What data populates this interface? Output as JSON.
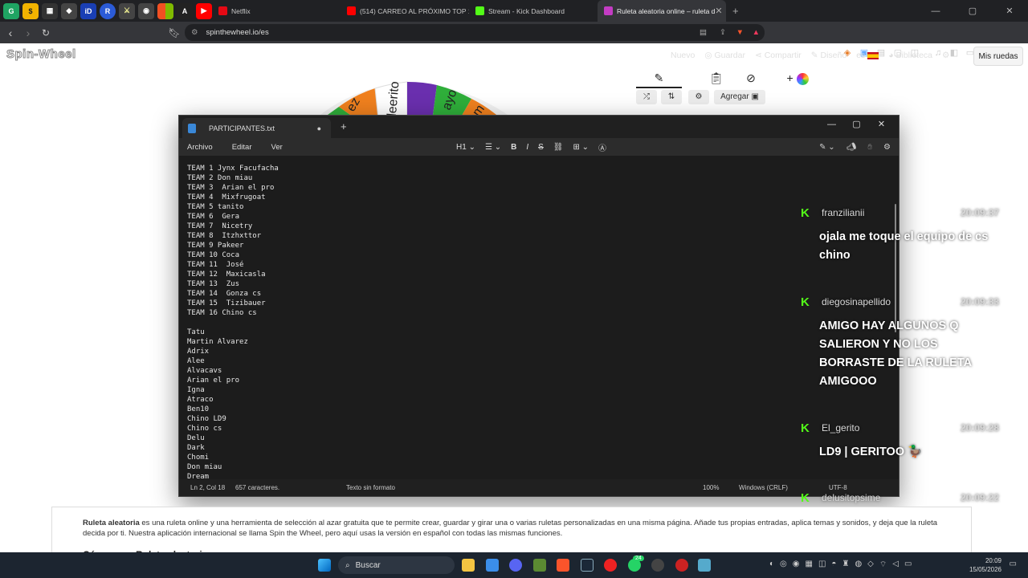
{
  "browser": {
    "tabs": [
      {
        "label": "Netflix",
        "color": "#e50914"
      },
      {
        "label": "(514) CARREO AL PRÓXIMO TOP 1 D",
        "color": "#ff0000"
      },
      {
        "label": "Stream - Kick Dashboard",
        "color": "#53fc18"
      },
      {
        "label": "Ruleta aleatoria online – ruleta d",
        "color": "#c43cc4",
        "active": true
      }
    ],
    "url": "spinthewheel.io/es"
  },
  "page": {
    "logo": "Spin-Wheel",
    "menu": [
      "Nuevo",
      "Guardar",
      "Compartir",
      "Diseño",
      "es",
      "Biblioteca"
    ],
    "mis_ruedas": "Mis ruedas",
    "agregar": "Agregar",
    "wheel_labels": [
      "ez",
      "aleerito",
      "ayo",
      "m"
    ],
    "description": "es una ruleta online y una herramienta de selección al azar gratuita que te permite crear, guardar y girar una o varias ruletas personalizadas en una misma página. Añade tus propias entradas, aplica temas y sonidos, y deja que la ruleta decida por ti. Nuestra aplicación internacional se llama Spin the Wheel, pero aquí usas la versión en español con todas las mismas funciones.",
    "description_strong": "Ruleta aleatoria",
    "howto_heading": "Cómo usar Ruleta aleatoria"
  },
  "notepad": {
    "tab_title": "PARTICIPANTES.txt",
    "menu": [
      "Archivo",
      "Editar",
      "Ver"
    ],
    "heading_select": "H1",
    "lines": [
      "TEAM 1 Jynx Facufacha",
      "TEAM 2 Don miau",
      "TEAM 3  Arian el pro",
      "TEAM 4  Mixfrugoat",
      "TEAM 5 tanito",
      "TEAM 6  Gera",
      "TEAM 7  Nicetry",
      "TEAM 8  Itzhxttor",
      "TEAM 9 Pakeer",
      "TEAM 10 Coca",
      "TEAM 11  José",
      "TEAM 12  Maxicasla",
      "TEAM 13  Zus",
      "TEAM 14  Gonza cs",
      "TEAM 15  Tizibauer",
      "TEAM 16 Chino cs",
      "",
      "Tatu",
      "Martin Alvarez",
      "Adrix",
      "Alee",
      "Alvacavs",
      "Arian el pro",
      "Igna",
      "Atraco",
      "Ben10",
      "Chino LD9",
      "Chino cs",
      "Delu",
      "Dark",
      "Chomi",
      "Don miau",
      "Dream"
    ],
    "status": {
      "position": "Ln 2, Col 18",
      "chars": "657 caracteres.",
      "format": "Texto sin formato",
      "zoom": "100%",
      "line_ending": "Windows (CRLF)",
      "encoding": "UTF-8"
    }
  },
  "chat": [
    {
      "user": "franzilianii",
      "time": "20:09:37",
      "message": "ojala me toque el equipo de cs chino"
    },
    {
      "user": "diegosinapellido",
      "time": "20:09:33",
      "message": "AMIGO HAY ALGUNOS Q SALIERON Y NO LOS BORRASTE DE LA RULETA AMIGOOO"
    },
    {
      "user": "El_gerito",
      "time": "20:09:28",
      "message": "LD9 | GERITOO 🦆"
    },
    {
      "user": "delusitopsime",
      "time": "20:09:22",
      "message": ""
    }
  ],
  "taskbar": {
    "search": "Buscar",
    "badge": "24",
    "time": "20:09",
    "date": "15/05/2026"
  }
}
